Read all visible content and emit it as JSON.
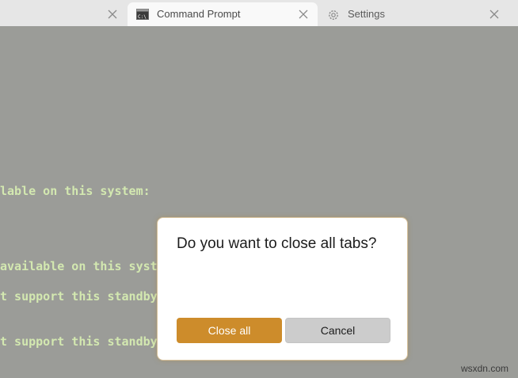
{
  "tabs": [
    {
      "label": "",
      "close": "×"
    },
    {
      "label": "Command Prompt",
      "icon": "command-prompt-icon",
      "icon_text": "C:\\",
      "close": "×"
    },
    {
      "label": "Settings",
      "icon": "gear-icon",
      "close": "×"
    }
  ],
  "console": {
    "lines": [
      "lable on this system:",
      "available on this syste",
      "t support this standby",
      "t support this standby"
    ],
    "text_color": "#d3e8b0",
    "background": "#9b9c98"
  },
  "dialog": {
    "title": "Do you want to close all tabs?",
    "confirm_label": "Close all",
    "cancel_label": "Cancel",
    "accent": "#cd8c2b"
  },
  "watermark": "wsxdn.com"
}
